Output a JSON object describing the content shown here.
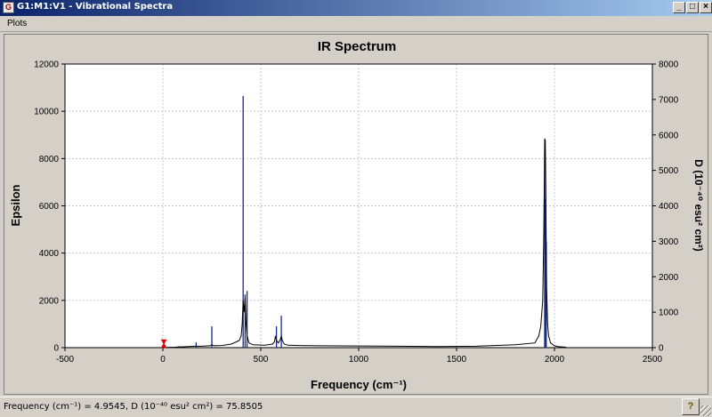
{
  "window": {
    "title": "G1:M1:V1 - Vibrational Spectra",
    "app_icon": "gaussview-icon",
    "minimize_glyph": "_",
    "maximize_glyph": "□",
    "close_glyph": "×"
  },
  "menu": {
    "plots_label": "Plots"
  },
  "status": {
    "text": "Frequency (cm⁻¹) = 4.9545, D (10⁻⁴⁰ esu² cm²) = 75.8505",
    "help_label": "?"
  },
  "colors": {
    "ir_trace": "#000000",
    "stick_bars": "#1a2a8c",
    "marker": "#e00000",
    "plot_bg": "#ffffff",
    "grid": "#c8c8c8"
  },
  "chart_data": {
    "type": "line",
    "title": "IR Spectrum",
    "xlabel": "Frequency (cm⁻¹)",
    "ylabel": "Epsilon",
    "y2label": "D (10⁻⁴⁰ esu² cm²)",
    "xlim": [
      -500,
      2500
    ],
    "ylim": [
      0,
      12000
    ],
    "y2lim": [
      0,
      8000
    ],
    "x_ticks": [
      -500,
      0,
      500,
      1000,
      1500,
      2000,
      2500
    ],
    "y_ticks": [
      0,
      2000,
      4000,
      6000,
      8000,
      10000,
      12000
    ],
    "y2_ticks": [
      0,
      1000,
      2000,
      3000,
      4000,
      5000,
      6000,
      7000,
      8000
    ],
    "grid": true,
    "marker_x": 4.9545,
    "series": [
      {
        "kind": "spectrum-curve",
        "axis": "left",
        "x": [
          -5,
          60,
          80,
          120,
          170,
          200,
          240,
          250,
          260,
          300,
          350,
          390,
          400,
          405,
          410,
          415,
          420,
          425,
          430,
          440,
          460,
          520,
          560,
          570,
          575,
          580,
          590,
          600,
          605,
          610,
          620,
          640,
          700,
          800,
          1000,
          1200,
          1400,
          1600,
          1800,
          1900,
          1920,
          1930,
          1940,
          1945,
          1950,
          1953,
          1955,
          1958,
          1960,
          1965,
          1970,
          1980,
          2000,
          2020,
          2060
        ],
        "y": [
          0,
          20,
          30,
          40,
          60,
          60,
          80,
          120,
          80,
          90,
          150,
          300,
          500,
          1000,
          2000,
          1500,
          2100,
          1000,
          500,
          200,
          120,
          100,
          150,
          250,
          500,
          300,
          200,
          350,
          500,
          300,
          150,
          100,
          90,
          80,
          70,
          60,
          50,
          60,
          120,
          200,
          500,
          900,
          2000,
          4500,
          8400,
          8800,
          7500,
          4000,
          2500,
          1000,
          500,
          200,
          80,
          40,
          20
        ]
      },
      {
        "kind": "stick-intensities",
        "axis": "right",
        "x": [
          8,
          80,
          170,
          250,
          410,
          420,
          430,
          580,
          605,
          1950,
          1954,
          1958
        ],
        "y": [
          30,
          40,
          150,
          600,
          7100,
          1500,
          1600,
          600,
          900,
          5900,
          4200,
          3000
        ]
      }
    ]
  }
}
